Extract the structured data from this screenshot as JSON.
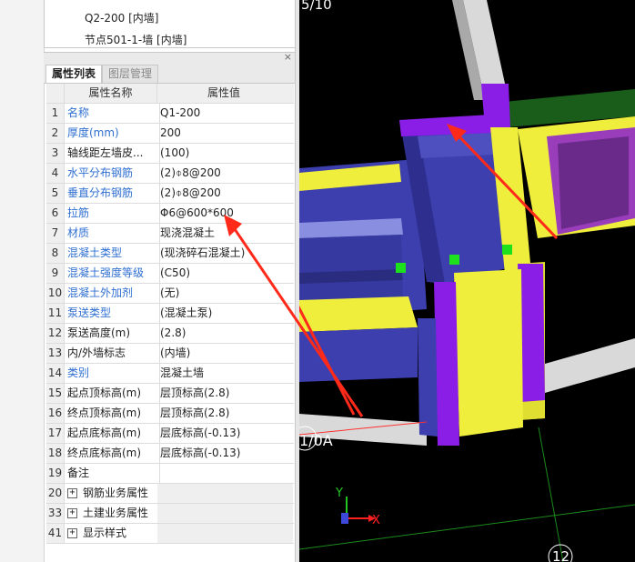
{
  "tree": {
    "items": [
      "Q2-200 [内墙]",
      "节点501-1-墙 [内墙]"
    ]
  },
  "panel": {
    "close_glyph": "×",
    "tabs": [
      "属性列表",
      "图层管理"
    ]
  },
  "table": {
    "headers": [
      "属性名称",
      "属性值"
    ],
    "rows": [
      {
        "num": "1",
        "name": "名称",
        "value": "Q1-200"
      },
      {
        "num": "2",
        "name": "厚度(mm)",
        "value": "200"
      },
      {
        "num": "3",
        "name": "轴线距左墙皮...",
        "value": "(100)"
      },
      {
        "num": "4",
        "name": "水平分布钢筋",
        "value": "(2)⌽8@200"
      },
      {
        "num": "5",
        "name": "垂直分布钢筋",
        "value": "(2)⌽8@200"
      },
      {
        "num": "6",
        "name": "拉筋",
        "value": "Φ6@600*600"
      },
      {
        "num": "7",
        "name": "材质",
        "value": "现浇混凝土"
      },
      {
        "num": "8",
        "name": "混凝土类型",
        "value": "(现浇碎石混凝土)"
      },
      {
        "num": "9",
        "name": "混凝土强度等级",
        "value": "(C50)"
      },
      {
        "num": "10",
        "name": "混凝土外加剂",
        "value": "(无)"
      },
      {
        "num": "11",
        "name": "泵送类型",
        "value": "(混凝土泵)"
      },
      {
        "num": "12",
        "name": "泵送高度(m)",
        "value": "(2.8)"
      },
      {
        "num": "13",
        "name": "内/外墙标志",
        "value": "(内墙)"
      },
      {
        "num": "14",
        "name": "类别",
        "value": "混凝土墙"
      },
      {
        "num": "15",
        "name": "起点顶标高(m)",
        "value": "层顶标高(2.8)"
      },
      {
        "num": "16",
        "name": "终点顶标高(m)",
        "value": "层顶标高(2.8)"
      },
      {
        "num": "17",
        "name": "起点底标高(m)",
        "value": "层底标高(-0.13)"
      },
      {
        "num": "18",
        "name": "终点底标高(m)",
        "value": "层底标高(-0.13)"
      },
      {
        "num": "19",
        "name": "备注",
        "value": ""
      }
    ],
    "groups": [
      {
        "num": "20",
        "label": "钢筋业务属性"
      },
      {
        "num": "33",
        "label": "土建业务属性"
      },
      {
        "num": "41",
        "label": "显示样式"
      }
    ],
    "plus_glyph": "+"
  },
  "viewport": {
    "labels": {
      "top_axis": "5/10",
      "axis_left": "1/0A",
      "axis_bottom": "12",
      "gizmo_x": "X",
      "gizmo_y": "Y"
    },
    "colors": {
      "background": "#000000",
      "wall_blue": "#3d3fae",
      "wall_yellow": "#f0ee3c",
      "column_purple": "#8a1ee6",
      "gray": "#d9d9d9",
      "green": "#1a5c1a",
      "marker": "#1ee11e",
      "arrow": "#ff2a1a"
    }
  }
}
